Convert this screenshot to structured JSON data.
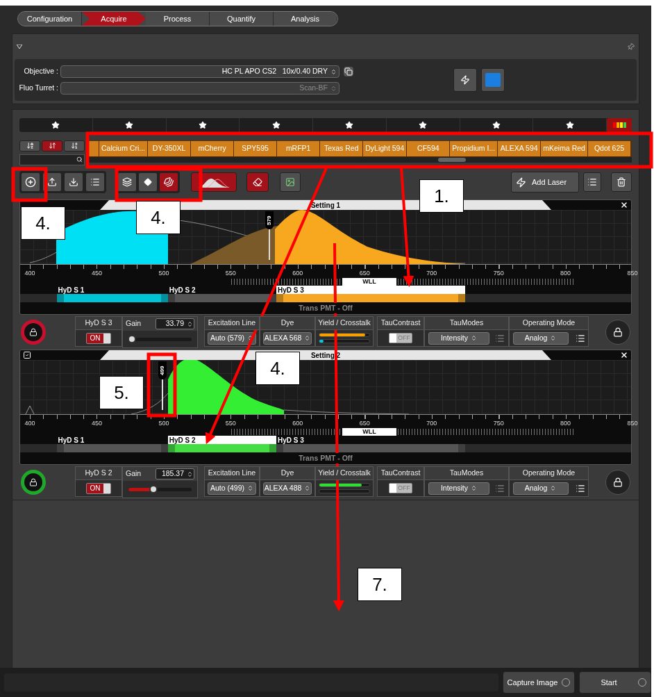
{
  "workflow": [
    {
      "label": "Configuration",
      "selected": false
    },
    {
      "label": "Acquire",
      "selected": true
    },
    {
      "label": "Process",
      "selected": false
    },
    {
      "label": "Quantify",
      "selected": false
    },
    {
      "label": "Analysis",
      "selected": false
    }
  ],
  "hardware": [
    {
      "label": "Objective :",
      "value": "HC PL APO CS2   10x/0.40 DRY",
      "disabled": false
    },
    {
      "label": "Fluo Turret :",
      "value": "Scan-BF",
      "disabled": true
    }
  ],
  "dyes": [
    "Calcium Cri...",
    "DY-350XL",
    "mCherry",
    "SPY595",
    "mRFP1",
    "Texas Red",
    "DyLight 594",
    "CF594",
    "Propidium I...",
    "ALEXA 594",
    "mKeima Red",
    "Qdot 625"
  ],
  "add_laser": "Add Laser",
  "settings": [
    {
      "title": "Setting 1",
      "selected": false,
      "color": "#c8102e",
      "marker": "579",
      "ticks": [
        "400",
        "450",
        "500",
        "550",
        "600",
        "650",
        "700",
        "750",
        "800",
        "850"
      ],
      "wll": "WLL",
      "detectors": [
        {
          "name": "HyD S 1",
          "color": "#00c4d4",
          "selected": false
        },
        {
          "name": "HyD S 2",
          "color": "#555555",
          "selected": false
        },
        {
          "name": "HyD S 3",
          "color": "#f5a623",
          "selected": true
        }
      ],
      "trans": "Trans PMT - Off",
      "channel": {
        "detector": "HyD S 3",
        "on": true,
        "on_label": "ON",
        "gain_label": "Gain",
        "gain": {
          "value": "33.79",
          "level": 0.05
        },
        "excitation_label": "Excitation Line",
        "excitation": "Auto (579)",
        "dye_label": "Dye",
        "dye": "ALEXA 568",
        "yield_label": "Yield / Crosstalk",
        "yield": [
          {
            "color": "#f5a000",
            "level": 0.92
          },
          {
            "color": "#00c8e8",
            "level": 0.08
          }
        ],
        "tau_label": "TauContrast",
        "tau": {
          "on": false,
          "text": "OFF"
        },
        "modes_label": "TauModes",
        "mode": "Intensity",
        "op_label": "Operating Mode",
        "op": "Analog"
      }
    },
    {
      "title": "Setting 2",
      "selected": true,
      "color": "#1fa82a",
      "marker": "499",
      "ticks": [
        "400",
        "450",
        "500",
        "550",
        "600",
        "650",
        "700",
        "750",
        "800",
        "850"
      ],
      "wll": "WLL",
      "detectors": [
        {
          "name": "HyD S 1",
          "color": "#555555",
          "selected": false
        },
        {
          "name": "HyD S 2",
          "color": "#44dd44",
          "selected": true
        },
        {
          "name": "HyD S 3",
          "color": "#555555",
          "selected": false
        }
      ],
      "trans": "Trans PMT - Off",
      "channel": {
        "detector": "HyD S 2",
        "on": true,
        "on_label": "ON",
        "gain_label": "Gain",
        "gain": {
          "value": "185.37",
          "level": 0.4
        },
        "excitation_label": "Excitation Line",
        "excitation": "Auto (499)",
        "dye_label": "Dye",
        "dye": "ALEXA 488",
        "yield_label": "Yield / Crosstalk",
        "yield": [
          {
            "color": "#30e030",
            "level": 0.85
          }
        ],
        "tau_label": "TauContrast",
        "tau": {
          "on": false,
          "text": "OFF"
        },
        "modes_label": "TauModes",
        "mode": "Intensity",
        "op_label": "Operating Mode",
        "op": "Analog"
      }
    }
  ],
  "buttons": [
    "Capture Image",
    "Start"
  ],
  "callouts": [
    "1.",
    "4.",
    "4.",
    "4.",
    "5.",
    "7."
  ]
}
